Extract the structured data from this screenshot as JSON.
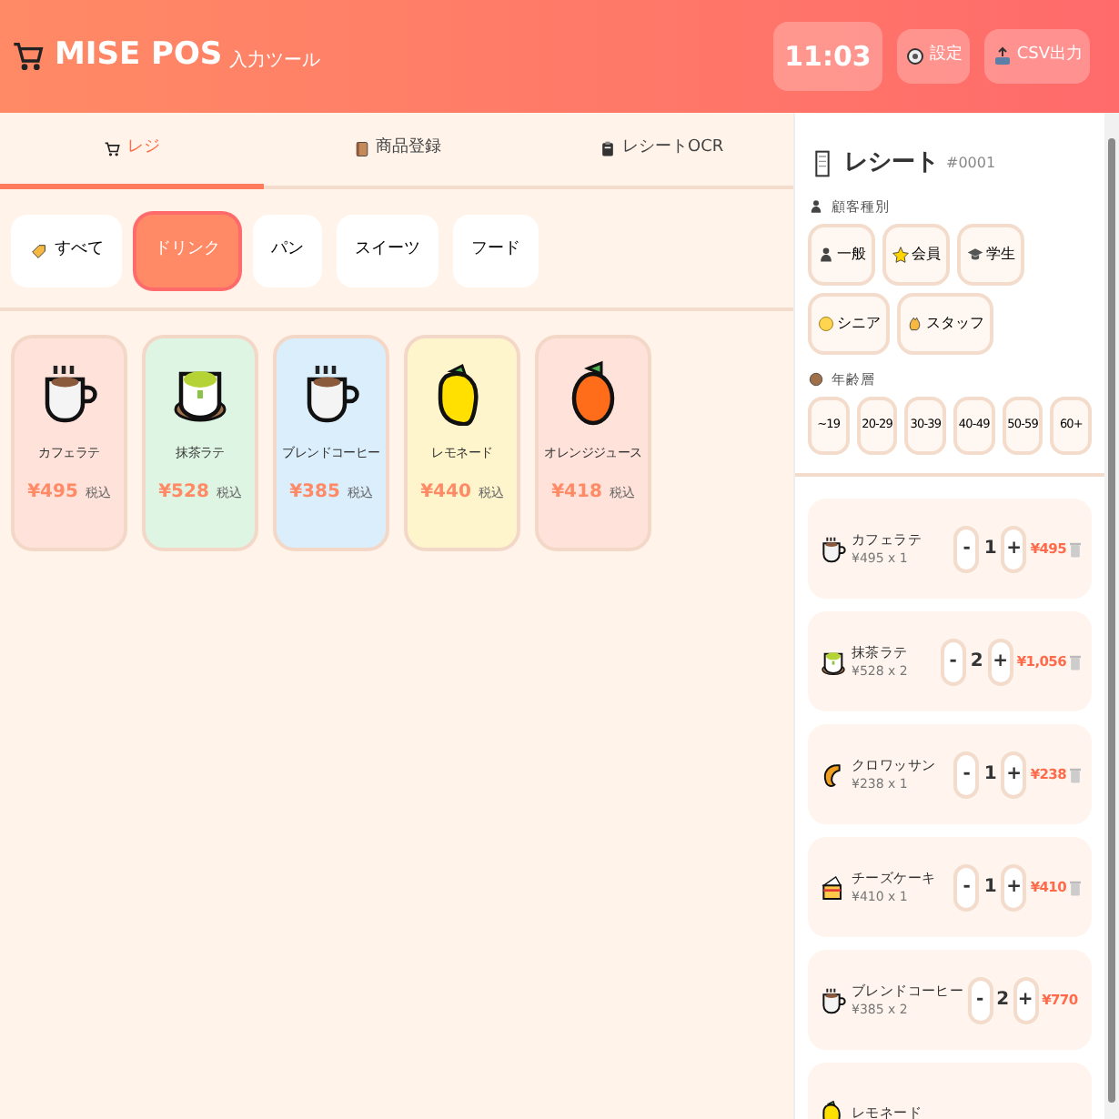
{
  "header": {
    "title": "MISE POS",
    "subtitle": "入力ツール",
    "time": "11:03",
    "buttons": [
      {
        "label": "設定"
      },
      {
        "label": "CSV出力"
      }
    ]
  },
  "tabs": [
    {
      "label": "レジ",
      "selected": true
    },
    {
      "label": "商品登録",
      "selected": false
    },
    {
      "label": "レシートOCR",
      "selected": false
    }
  ],
  "categories": [
    {
      "label": "すべて",
      "selected": false
    },
    {
      "label": "ドリンク",
      "selected": true
    },
    {
      "label": "パン",
      "selected": false
    },
    {
      "label": "スイーツ",
      "selected": false
    },
    {
      "label": "フード",
      "selected": false
    }
  ],
  "products": [
    {
      "name": "カフェラテ",
      "price": "¥495",
      "tax": "税込",
      "kind": "coffee",
      "color": "#ffe3da"
    },
    {
      "name": "抹茶ラテ",
      "price": "¥528",
      "tax": "税込",
      "kind": "matcha",
      "color": "#dff5e3"
    },
    {
      "name": "ブレンドコーヒー",
      "price": "¥385",
      "tax": "税込",
      "kind": "coffee",
      "color": "#dbeefc"
    },
    {
      "name": "レモネード",
      "price": "¥440",
      "tax": "税込",
      "kind": "lemon",
      "color": "#fff5cc"
    },
    {
      "name": "オレンジジュース",
      "price": "¥418",
      "tax": "税込",
      "kind": "orange",
      "color": "#ffe3da"
    }
  ],
  "receipt": {
    "title": "レシート",
    "number": "#0001",
    "customer_label": "顧客種別",
    "customer_types": [
      {
        "label": "一般",
        "selected": false
      },
      {
        "label": "会員",
        "selected": false
      },
      {
        "label": "学生",
        "selected": false
      },
      {
        "label": "シニア",
        "selected": false
      },
      {
        "label": "スタッフ",
        "selected": false
      }
    ],
    "age_label": "年齢層",
    "age_groups": [
      {
        "label": "~19",
        "selected": false
      },
      {
        "label": "20-29",
        "selected": false
      },
      {
        "label": "30-39",
        "selected": false
      },
      {
        "label": "40-49",
        "selected": false
      },
      {
        "label": "50-59",
        "selected": false
      },
      {
        "label": "60+",
        "selected": false
      }
    ],
    "items": [
      {
        "name": "カフェラテ",
        "detail": "¥495 x 1",
        "minus": "-",
        "qty": "1",
        "plus": "+",
        "total": "¥495",
        "kind": "coffee"
      },
      {
        "name": "抹茶ラテ",
        "detail": "¥528 x 2",
        "minus": "-",
        "qty": "2",
        "plus": "+",
        "total": "¥1,056",
        "kind": "matcha"
      },
      {
        "name": "クロワッサン",
        "detail": "¥238 x 1",
        "minus": "-",
        "qty": "1",
        "plus": "+",
        "total": "¥238",
        "kind": "croissant"
      },
      {
        "name": "チーズケーキ",
        "detail": "¥410 x 1",
        "minus": "-",
        "qty": "1",
        "plus": "+",
        "total": "¥410",
        "kind": "cake"
      },
      {
        "name": "ブレンドコーヒー",
        "detail": "¥385 x 2",
        "minus": "-",
        "qty": "2",
        "plus": "+",
        "total": "¥770",
        "kind": "coffee"
      },
      {
        "name": "レモネード",
        "kind": "lemon"
      }
    ]
  }
}
